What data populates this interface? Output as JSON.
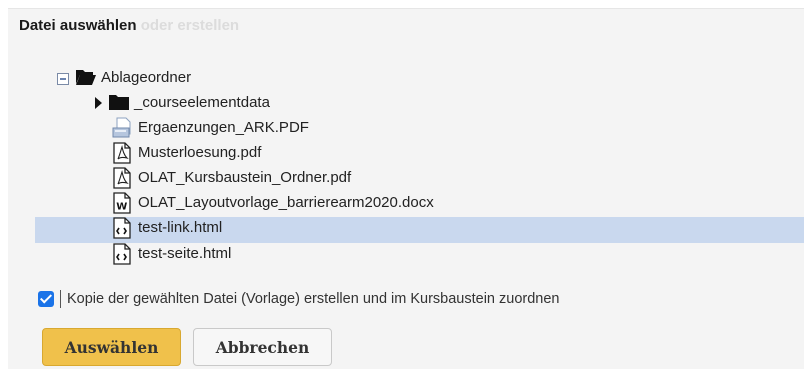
{
  "header": {
    "title": "Datei auswählen",
    "alt_title": "oder erstellen"
  },
  "tree": {
    "root": {
      "label": "Ablageordner",
      "expander": "collapse-minus-icon",
      "icon": "open-folder-icon"
    },
    "items": [
      {
        "label": "_courseelementdata",
        "icon": "folder-icon",
        "expander": "expand-arrow-icon"
      },
      {
        "label": "Ergaenzungen_ARK.PDF",
        "icon": "generic-file-icon"
      },
      {
        "label": "Musterloesung.pdf",
        "icon": "pdf-file-icon"
      },
      {
        "label": "OLAT_Kursbaustein_Ordner.pdf",
        "icon": "pdf-file-icon"
      },
      {
        "label": "OLAT_Layoutvorlage_barrierearm2020.docx",
        "icon": "word-file-icon"
      },
      {
        "label": "test-link.html",
        "icon": "html-file-icon",
        "selected": true
      },
      {
        "label": "test-seite.html",
        "icon": "html-file-icon"
      }
    ]
  },
  "option": {
    "label": "Kopie der gewählten Datei (Vorlage) erstellen und im Kursbaustein zuordnen",
    "checked": true
  },
  "buttons": {
    "select": "Auswählen",
    "cancel": "Abbrechen"
  },
  "colors": {
    "selection": "#c9d8ee",
    "primary_button": "#f0c14b",
    "checkbox": "#1a73e8"
  }
}
